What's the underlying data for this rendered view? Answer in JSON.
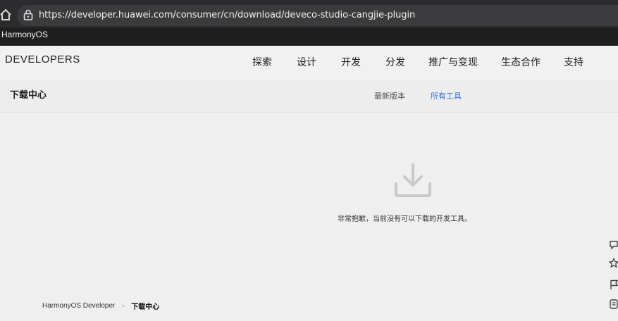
{
  "browser": {
    "url": "https://developer.huawei.com/consumer/cn/download/deveco-studio-cangjie-plugin",
    "tab_label": "HarmonyOS"
  },
  "header": {
    "brand": "DEVELOPERS",
    "nav": [
      "探索",
      "设计",
      "开发",
      "分发",
      "推广与变现",
      "生态合作",
      "支持"
    ]
  },
  "subheader": {
    "title": "下载中心",
    "tabs": [
      {
        "label": "最新版本",
        "color": "#555555"
      },
      {
        "label": "所有工具",
        "color": "#3e6fd8"
      }
    ]
  },
  "empty_state": {
    "icon": "download-icon",
    "message": "非常抱歉，当前没有可以下载的开发工具。"
  },
  "breadcrumb": {
    "home": "HarmonyOS Developer",
    "separator": ">",
    "current": "下载中心"
  },
  "side_tools": [
    "feedback-icon",
    "star-icon",
    "flag-icon",
    "note-icon"
  ],
  "colors": {
    "browser_bg": "#2c2c2e",
    "page_bg": "#efefef",
    "link_blue": "#3e6fd8"
  }
}
